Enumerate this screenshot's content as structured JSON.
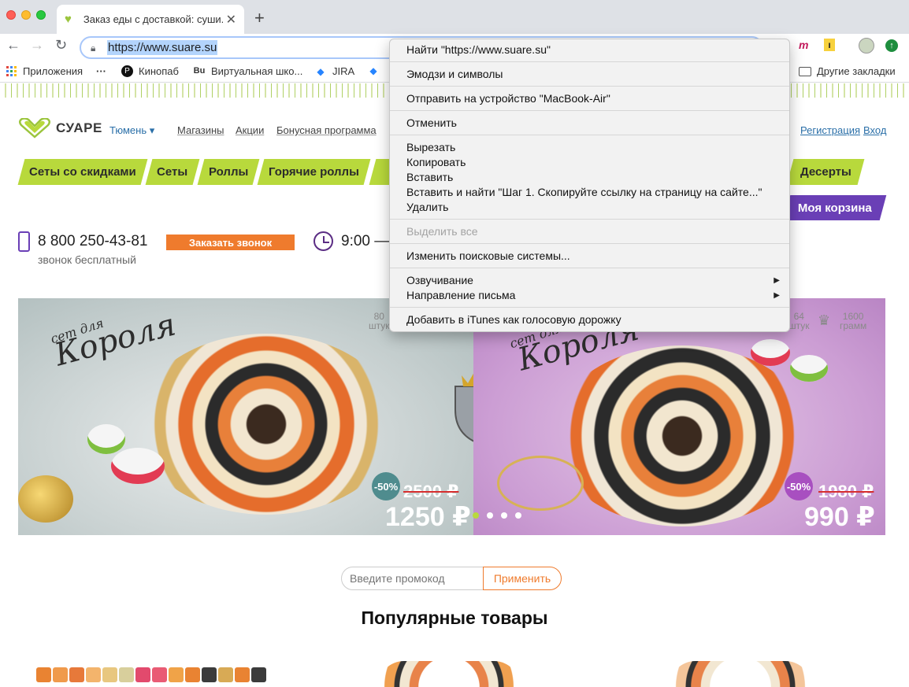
{
  "browser": {
    "tab_title": "Заказ еды с доставкой: суши...",
    "url": "https://www.suare.su",
    "bookmarks": [
      "Приложения",
      "Кинопаб",
      "Виртуальная шко...",
      "JIRA",
      "Другие закладки"
    ]
  },
  "site": {
    "logo": "СУАРЕ",
    "city": "Тюмень ▾",
    "nav": [
      "Магазины",
      "Акции",
      "Бонусная программа"
    ],
    "auth": {
      "register": "Регистрация",
      "login": "Вход"
    },
    "categories": [
      "Сеты со скидками",
      "Сеты",
      "Роллы",
      "Горячие роллы",
      "Десерты"
    ],
    "cart": "Моя корзина",
    "phone": "8 800 250-43-81",
    "phone_note": "звонок бесплатный",
    "call_button": "Заказать звонок",
    "hours": "9:00 —"
  },
  "banner": {
    "left": {
      "small": "сет для",
      "title": "Короля",
      "qty_num": "80",
      "qty_unit": "штук",
      "discount": "-50%",
      "old_price": "2500 ₽",
      "new_price": "1250 ₽"
    },
    "right": {
      "small": "сет для",
      "title": "Короля",
      "qty_num": "64",
      "qty_unit": "штук",
      "weight_num": "1600",
      "weight_unit": "грамм",
      "discount": "-50%",
      "old_price": "1980 ₽",
      "new_price": "990 ₽"
    }
  },
  "promo": {
    "placeholder": "Введите промокод",
    "apply": "Применить"
  },
  "popular_title": "Популярные товары",
  "context_menu": {
    "group1": [
      "Найти \"https://www.suare.su\""
    ],
    "group2": [
      "Эмодзи и символы"
    ],
    "group3": [
      "Отправить на устройство \"MacBook-Air\""
    ],
    "group4": [
      "Отменить"
    ],
    "group5": [
      "Вырезать",
      "Копировать",
      "Вставить",
      "Вставить и найти \"Шаг 1. Скопируйте ссылку на страницу на сайте...\"",
      "Удалить"
    ],
    "group6": [
      "Выделить все"
    ],
    "group7": [
      "Изменить поисковые системы..."
    ],
    "group8": [
      "Озвучивание",
      "Направление письма"
    ],
    "group9": [
      "Добавить в iTunes как голосовую дорожку"
    ]
  },
  "colors": {
    "brand_green": "#b8d93c",
    "brand_purple": "#6a3fb6",
    "accent_orange": "#ef7b2d"
  }
}
